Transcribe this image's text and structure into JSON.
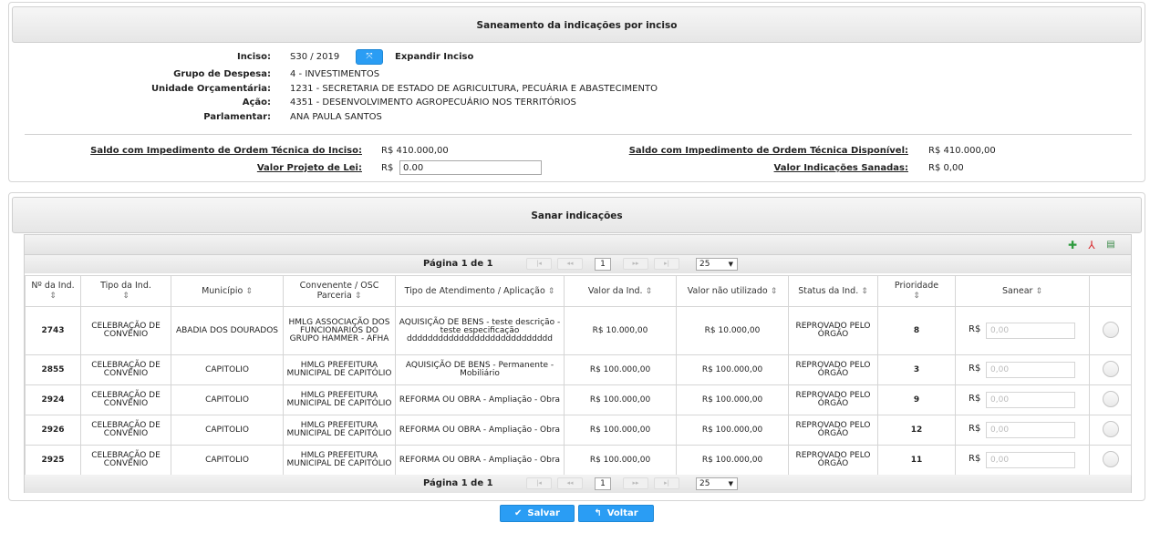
{
  "section1": {
    "title": "Saneamento da indicações por inciso",
    "fields": [
      {
        "label": "Inciso:",
        "value": "S30 / 2019"
      },
      {
        "label": "Grupo de Despesa:",
        "value": "4 - INVESTIMENTOS"
      },
      {
        "label": "Unidade Orçamentária:",
        "value": "1231 - SECRETARIA DE ESTADO DE AGRICULTURA, PECUÁRIA E ABASTECIMENTO"
      },
      {
        "label": "Ação:",
        "value": "4351 - DESENVOLVIMENTO AGROPECUÁRIO NOS TERRITÓRIOS"
      },
      {
        "label": "Parlamentar:",
        "value": "ANA PAULA SANTOS"
      }
    ],
    "expand_label": "Expandir Inciso",
    "expand_icon": "expand-icon",
    "summary": {
      "saldo_inciso_label": "Saldo com Impedimento de Ordem Técnica do Inciso:",
      "saldo_inciso_value": "R$ 410.000,00",
      "valor_projeto_label": "Valor Projeto de Lei:",
      "valor_projeto_currency": "R$",
      "valor_projeto_value": "0.00",
      "saldo_disponivel_label": "Saldo com Impedimento de Ordem Técnica Disponível:",
      "saldo_disponivel_value": "R$ 410.000,00",
      "valor_sanadas_label": "Valor Indicações Sanadas:",
      "valor_sanadas_value": "R$ 0,00"
    }
  },
  "section2": {
    "title": "Sanar indicações",
    "export_icons": [
      "excel-icon",
      "pdf-icon",
      "print-icon"
    ],
    "paginator": {
      "current_label": "Página 1 de 1",
      "page": "1",
      "rows_per_page": "25",
      "first": "|◂",
      "prev": "◂◂",
      "next": "▸▸",
      "last": "▸|"
    },
    "columns": [
      "Nº da Ind.",
      "Tipo da Ind.",
      "Município",
      "Convenente / OSC Parceria",
      "Tipo de Atendimento / Aplicação",
      "Valor da Ind.",
      "Valor não utilizado",
      "Status da Ind.",
      "Prioridade",
      "Sanear",
      ""
    ],
    "sort_icon": "⇕",
    "rows": [
      {
        "num": "2743",
        "tipo": "CELEBRAÇÃO DE CONVÊNIO",
        "municipio": "ABADIA DOS DOURADOS",
        "convenente": "HMLG ASSOCIAÇÃO DOS FUNCIONARIOS DO GRUPO HAMMER - AFHA",
        "atendimento": "AQUISIÇÃO DE BENS - teste descrição - teste especificação dddddddddddddddddddddddddddd",
        "valor": "R$ 10.000,00",
        "nao_utilizado": "R$ 10.000,00",
        "status": "REPROVADO PELO ÓRGÃO",
        "prioridade": "8",
        "currency": "R$",
        "placeholder": "0,00"
      },
      {
        "num": "2855",
        "tipo": "CELEBRAÇÃO DE CONVÊNIO",
        "municipio": "CAPITOLIO",
        "convenente": "HMLG PREFEITURA MUNICIPAL DE CAPITÓLIO",
        "atendimento": "AQUISIÇÃO DE BENS - Permanente - Mobiliário",
        "valor": "R$ 100.000,00",
        "nao_utilizado": "R$ 100.000,00",
        "status": "REPROVADO PELO ÓRGÃO",
        "prioridade": "3",
        "currency": "R$",
        "placeholder": "0,00"
      },
      {
        "num": "2924",
        "tipo": "CELEBRAÇÃO DE CONVÊNIO",
        "municipio": "CAPITOLIO",
        "convenente": "HMLG PREFEITURA MUNICIPAL DE CAPITÓLIO",
        "atendimento": "REFORMA OU OBRA - Ampliação - Obra",
        "valor": "R$ 100.000,00",
        "nao_utilizado": "R$ 100.000,00",
        "status": "REPROVADO PELO ÓRGÃO",
        "prioridade": "9",
        "currency": "R$",
        "placeholder": "0,00"
      },
      {
        "num": "2926",
        "tipo": "CELEBRAÇÃO DE CONVÊNIO",
        "municipio": "CAPITOLIO",
        "convenente": "HMLG PREFEITURA MUNICIPAL DE CAPITÓLIO",
        "atendimento": "REFORMA OU OBRA - Ampliação - Obra",
        "valor": "R$ 100.000,00",
        "nao_utilizado": "R$ 100.000,00",
        "status": "REPROVADO PELO ÓRGÃO",
        "prioridade": "12",
        "currency": "R$",
        "placeholder": "0,00"
      },
      {
        "num": "2925",
        "tipo": "CELEBRAÇÃO DE CONVÊNIO",
        "municipio": "CAPITOLIO",
        "convenente": "HMLG PREFEITURA MUNICIPAL DE CAPITÓLIO",
        "atendimento": "REFORMA OU OBRA - Ampliação - Obra",
        "valor": "R$ 100.000,00",
        "nao_utilizado": "R$ 100.000,00",
        "status": "REPROVADO PELO ÓRGÃO",
        "prioridade": "11",
        "currency": "R$",
        "placeholder": "0,00"
      }
    ]
  },
  "actions": {
    "save_label": "Salvar",
    "save_icon": "check-circle-icon",
    "back_label": "Voltar",
    "back_icon": "undo-arrow-icon"
  },
  "colors": {
    "accent": "#2a9df4",
    "status_link": "#1a37c9"
  }
}
